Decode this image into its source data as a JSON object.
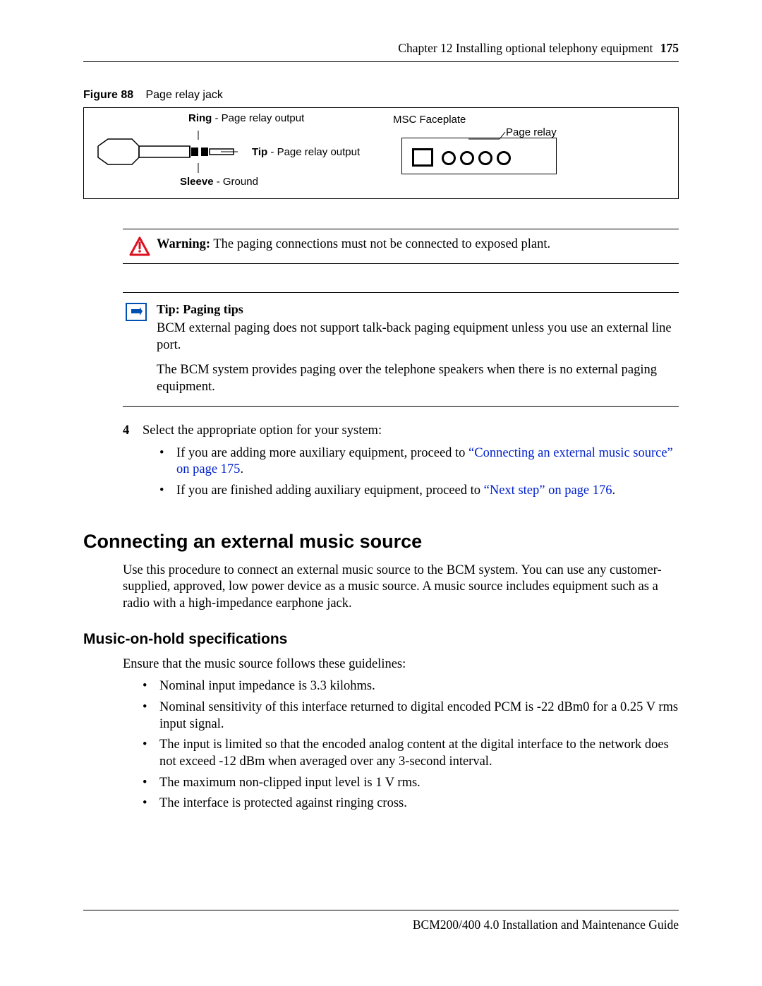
{
  "header": {
    "chapter": "Chapter 12  Installing optional telephony equipment",
    "page": "175"
  },
  "figure": {
    "label": "Figure 88",
    "title": "Page relay jack",
    "ring_bold": "Ring",
    "ring_rest": " - Page relay output",
    "tip_bold": "Tip",
    "tip_rest": " - Page relay output",
    "sleeve_bold": "Sleeve",
    "sleeve_rest": " - Ground",
    "msc": "MSC Faceplate",
    "pagerelay": "Page relay"
  },
  "warning": {
    "label": "Warning:",
    "text": " The paging connections must not be connected to exposed plant."
  },
  "tip": {
    "label": "Tip:",
    "title": " Paging tips",
    "p1": "BCM external paging does not support talk-back paging equipment unless you use an external line port.",
    "p2": "The BCM system provides paging over the telephone speakers when there is no external paging equipment."
  },
  "step4": {
    "num": "4",
    "text": "Select the appropriate option for your system:",
    "b1_pre": "If you are adding more auxiliary equipment, proceed to ",
    "b1_link": "“Connecting an external music source” on page 175",
    "b1_post": ".",
    "b2_pre": "If you are finished adding auxiliary equipment, proceed to ",
    "b2_link": "“Next step” on page 176",
    "b2_post": "."
  },
  "section": {
    "h1": "Connecting an external music source",
    "p": "Use this procedure to connect an external music source to the BCM system. You can use any customer-supplied, approved, low power device as a music source. A music source includes equipment such as a radio with a high-impedance earphone jack."
  },
  "sub": {
    "h2": "Music-on-hold specifications",
    "p": "Ensure that the music source follows these guidelines:",
    "items": [
      "Nominal input impedance is 3.3 kilohms.",
      "Nominal sensitivity of this interface returned to digital encoded PCM is -22 dBm0 for a 0.25 V rms input signal.",
      "The input is limited so that the encoded analog content at the digital interface to the network does not exceed -12 dBm when averaged over any 3-second interval.",
      "The maximum non-clipped input level is 1 V rms.",
      "The interface is protected against ringing cross."
    ]
  },
  "footer": "BCM200/400 4.0 Installation and Maintenance Guide"
}
